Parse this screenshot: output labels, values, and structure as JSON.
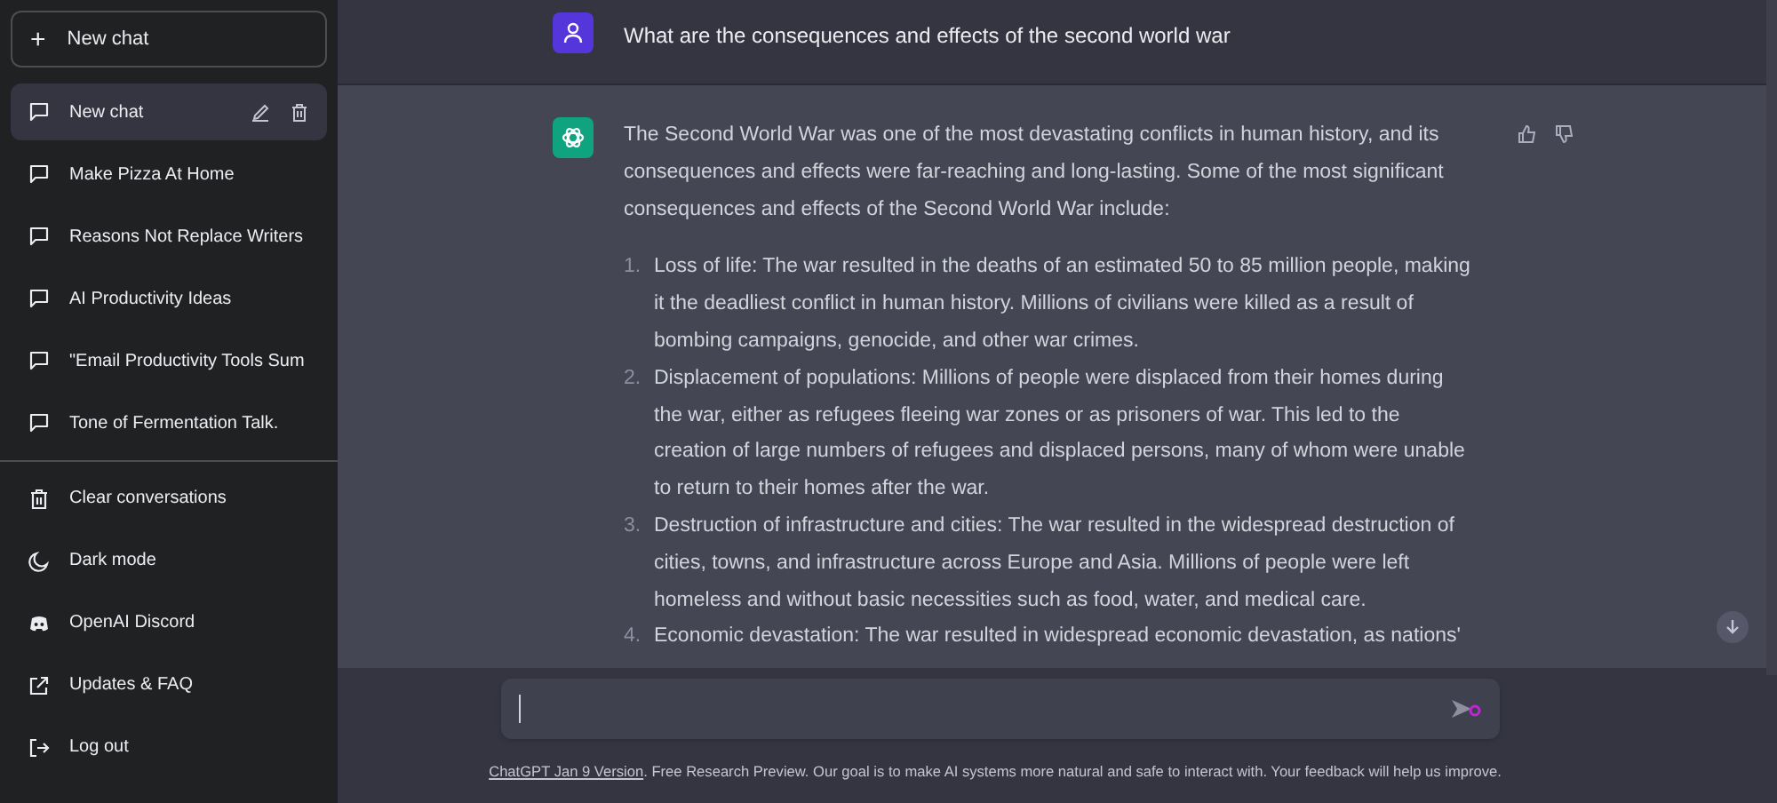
{
  "sidebar": {
    "new_chat_button": {
      "label": "New chat",
      "icon": "+"
    },
    "conversations": [
      {
        "title": "New chat",
        "selected": true
      },
      {
        "title": "Make Pizza At Home",
        "selected": false
      },
      {
        "title": "Reasons Not Replace Writers",
        "selected": false
      },
      {
        "title": "AI Productivity Ideas",
        "selected": false
      },
      {
        "title": "\"Email Productivity Tools Sum",
        "selected": false
      },
      {
        "title": "Tone of Fermentation Talk.",
        "selected": false
      }
    ],
    "menu": [
      {
        "kind": "trash",
        "label": "Clear conversations"
      },
      {
        "kind": "moon",
        "label": "Dark mode"
      },
      {
        "kind": "discord",
        "label": "OpenAI Discord"
      },
      {
        "kind": "external",
        "label": "Updates & FAQ"
      },
      {
        "kind": "logout",
        "label": "Log out"
      }
    ]
  },
  "messages": [
    {
      "kind": "user",
      "text": "What are the consequences and effects of the second world war"
    },
    {
      "kind": "assistant",
      "intro": "The Second World War was one of the most devastating conflicts in human history, and its consequences and effects were far-reaching and long-lasting. Some of the most significant consequences and effects of the Second World War include:",
      "items": [
        {
          "number": "1.",
          "text": "Loss of life: The war resulted in the deaths of an estimated 50 to 85 million people, making it the deadliest conflict in human history. Millions of civilians were killed as a result of bombing campaigns, genocide, and other war crimes."
        },
        {
          "number": "2.",
          "text": "Displacement of populations: Millions of people were displaced from their homes during the war, either as refugees fleeing war zones or as prisoners of war. This led to the creation of large numbers of refugees and displaced persons, many of whom were unable to return to their homes after the war."
        },
        {
          "number": "3.",
          "text": "Destruction of infrastructure and cities: The war resulted in the widespread destruction of cities, towns, and infrastructure across Europe and Asia. Millions of people were left homeless and without basic necessities such as food, water, and medical care."
        },
        {
          "number": "4.",
          "text": "Economic devastation: The war resulted in widespread economic devastation, as nations'"
        }
      ]
    }
  ],
  "footer": {
    "link": "ChatGPT Jan 9 Version",
    "text": ". Free Research Preview. Our goal is to make AI systems more natural and safe to interact with. Your feedback will help us improve."
  }
}
